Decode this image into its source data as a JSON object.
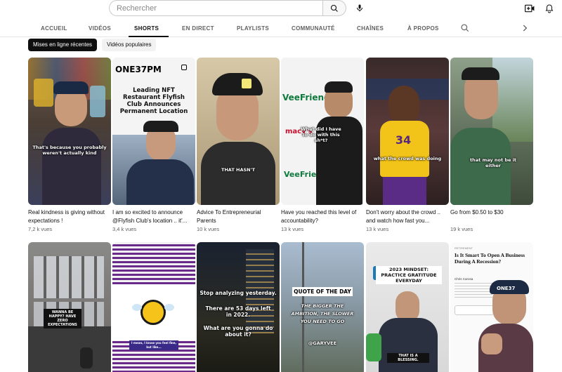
{
  "search": {
    "placeholder": "Rechercher"
  },
  "tabs": [
    {
      "label": "ACCUEIL"
    },
    {
      "label": "VIDÉOS"
    },
    {
      "label": "SHORTS"
    },
    {
      "label": "EN DIRECT"
    },
    {
      "label": "PLAYLISTS"
    },
    {
      "label": "COMMUNAUTÉ"
    },
    {
      "label": "CHAÎNES"
    },
    {
      "label": "À PROPOS"
    }
  ],
  "chips": [
    {
      "label": "Mises en ligne récentes"
    },
    {
      "label": "Vidéos populaires"
    }
  ],
  "row1": [
    {
      "title": "Real kindness is giving without expectations !",
      "views": "7,2 k vues",
      "overlay": "That's because you probably weren't actually kind"
    },
    {
      "title": "I am so excited to announce @Flyfish Club's location .. it'...",
      "views": "3,4 k vues",
      "brand": "ONE37PM",
      "headline": "Leading NFT Restaurant Flyfish Club Announces Permanent Location"
    },
    {
      "title": "Advice To Entrepreneurial Parents",
      "views": "10 k vues",
      "overlay": "THAT HASN'T"
    },
    {
      "title": "Have you reached this level of accountability?",
      "views": "13 k vues",
      "overlay": "What did I have to do with this sh*t?",
      "wall_text": "VeeFriends",
      "wall_text2": "macy's"
    },
    {
      "title": "Don't worry about the crowd .. and watch how fast you...",
      "views": "13 k vues",
      "overlay": "what the crowd was doing",
      "jersey": "34"
    },
    {
      "title": "Go from $0.50 to $30",
      "views": "19 k vues",
      "overlay": "that may not be it either"
    }
  ],
  "row2": [
    {
      "sign": "WANNA BE HAPPY? HAVE ZERO EXPECTATIONS"
    },
    {
      "caption": "I mean, I know you feel fine, but like..."
    },
    {
      "line1": "Stop analyzing yesterday.",
      "line2": "There are 53 days left in 2022.",
      "line3": "What are you gonna do about it?"
    },
    {
      "label": "QUOTE OF THE DAY",
      "quote": "THE BIGGER THE AMBITION, THE SLOWER YOU NEED TO GO",
      "handle": "@GARYVEE"
    },
    {
      "headline": "2023 MINDSET: PRACTICE GRATITUDE EVERYDAY",
      "bottom": "THAT IS A BLESSING."
    },
    {
      "kicker": "RETIREMENT",
      "headline": "Is It Smart To Open A Business During A Recession?",
      "author": "Chris Carosa",
      "cap": "ONE37"
    }
  ],
  "colors": {
    "accent": "#0f0f0f",
    "chip_bg": "#f2f2f2",
    "meta": "#606060"
  }
}
